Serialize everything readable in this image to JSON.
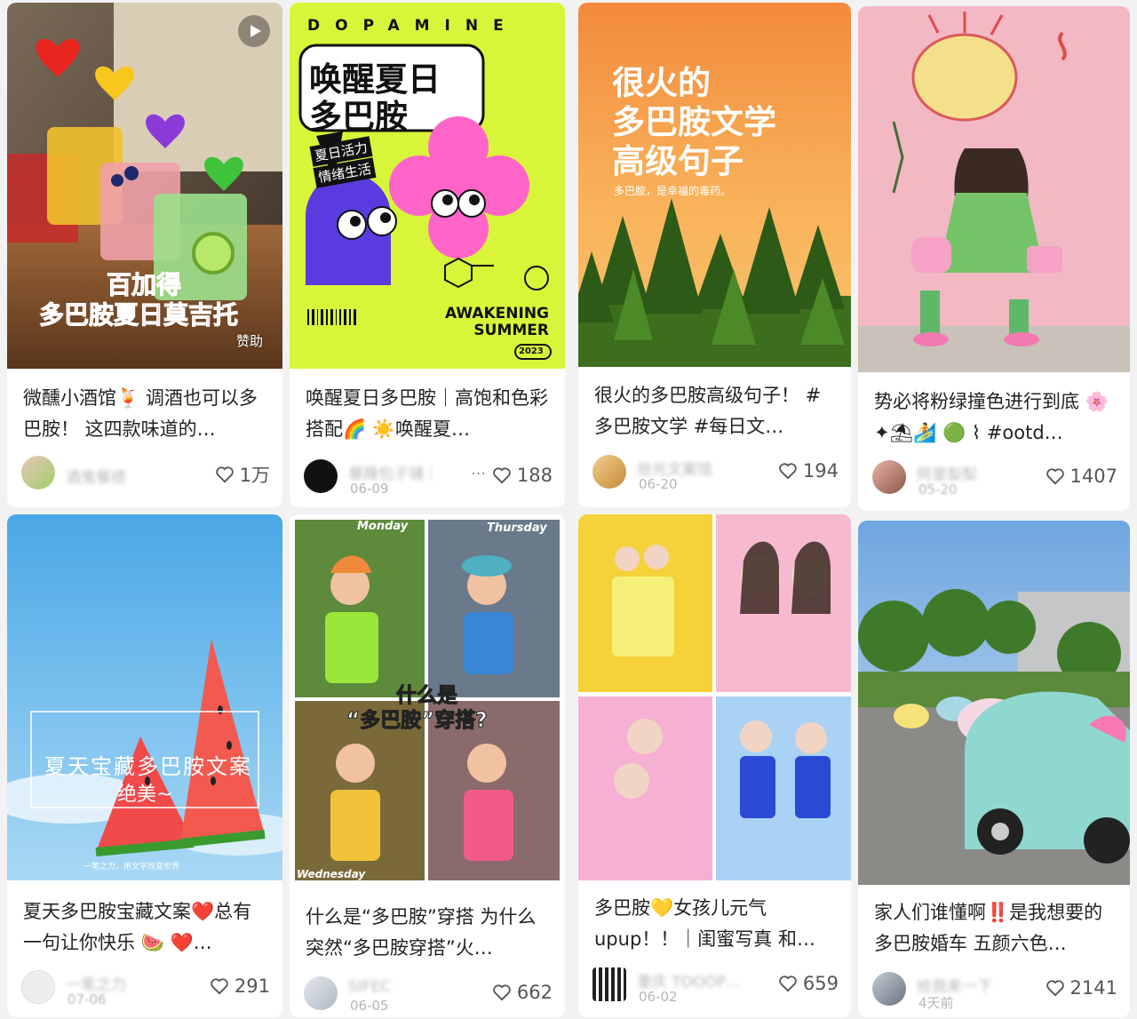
{
  "colors": {
    "accent": "#ff2e5a",
    "heart": "#555555",
    "meta_text": "#b5b5b5"
  },
  "icons": {
    "like": "heart-outline-icon",
    "play": "play-icon"
  },
  "cards": [
    {
      "cover_text": [
        "百加得",
        "多巴胺夏日莫吉托"
      ],
      "badge": "赞助",
      "title": "微醺小酒馆🍹 调酒也可以多巴胺！ 这四款味道的…",
      "author": "酒鬼餐绩",
      "date": "",
      "likes": "1万"
    },
    {
      "cover_text": [
        "DOPAMINE",
        "唤醒夏日",
        "多巴胺",
        "夏日活力",
        "情绪生活",
        "AWAKENING",
        "SUMMER",
        "2023"
      ],
      "title": "唤醒夏日多巴胺｜高饱和色彩搭配🌈 ☀️唤醒夏…",
      "author": "暴躁包子铺｜",
      "date": "06-09",
      "likes": "188"
    },
    {
      "cover_text": [
        "很火的",
        "多巴胺文学",
        "高级句子",
        "多巴胺，是幸福的毒药。"
      ],
      "title": "很火的多巴胺高级句子！ #多巴胺文学 #每日文…",
      "author": "拾光文案馆",
      "date": "06-20",
      "likes": "194"
    },
    {
      "title": "势必将粉绿撞色进行到底 🌸✦⛱🏄 🟢 ⌇ #ootd…",
      "author": "阿里梨梨",
      "date": "05-20",
      "likes": "1407"
    },
    {
      "cover_text": [
        "夏天宝藏多巴胺文案",
        "绝美~",
        "一笔之力，用文字改变世界"
      ],
      "title": "夏天多巴胺宝藏文案❤️总有一句让你快乐 🍉 ❤️…",
      "author": "一笔之力",
      "date": "07-06",
      "likes": "291"
    },
    {
      "cover_text": [
        "Monday",
        "Thursday",
        "什么是",
        "“多巴胺”穿搭?",
        "Wednesday"
      ],
      "title": "什么是“多巴胺”穿搭 为什么突然“多巴胺穿搭”火…",
      "author": "SIFEC",
      "date": "06-05",
      "likes": "662"
    },
    {
      "title": "多巴胺💛女孩儿元气upup！！｜闺蜜写真 和…",
      "author": "重庆 TOOOP…",
      "date": "06-02",
      "likes": "659"
    },
    {
      "title": "家人们谁懂啊‼️是我想要的多巴胺婚车 五颜六色…",
      "author": "给我来一下",
      "date": "4天前",
      "likes": "2141"
    }
  ]
}
